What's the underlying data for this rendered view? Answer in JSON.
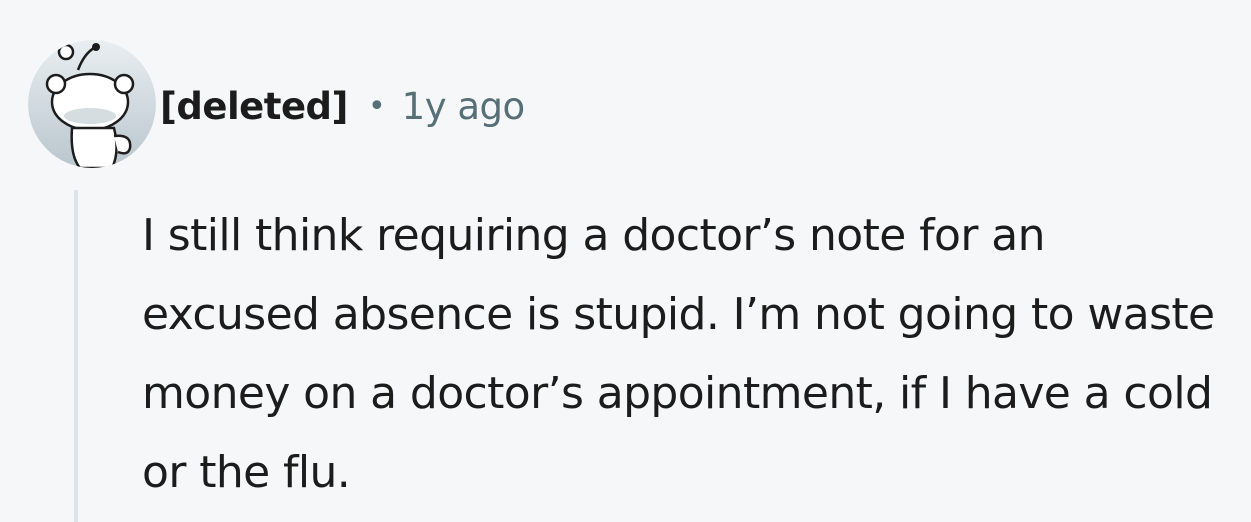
{
  "comment": {
    "author": "[deleted]",
    "separator": "•",
    "timestamp": "1y ago",
    "body": "I still think requiring a doctor’s note for an excused absence is stupid. I’m not going to waste money on a doctor’s appointment, if I have a cold or the flu.",
    "avatar_icon": "snoo-avatar-icon"
  },
  "colors": {
    "background": "#f6f7f8",
    "text": "#1c1c1c",
    "meta": "#576f76",
    "thread_line": "#dde3e6",
    "avatar_bg": "#c8d2d8"
  }
}
